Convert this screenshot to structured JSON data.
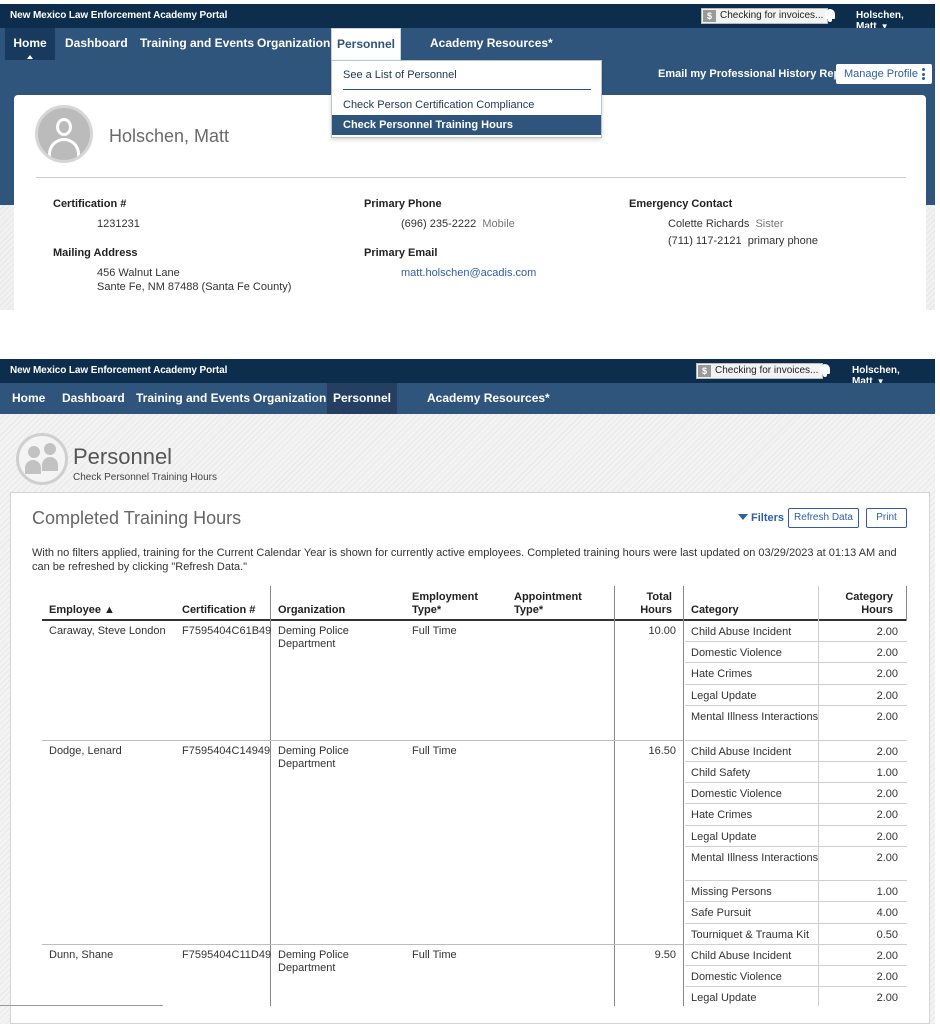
{
  "screen1": {
    "brand": "New Mexico Law Enforcement Academy Portal",
    "invoice_text": "Checking for invoices...",
    "invoice_icon": "dollar-icon",
    "user_name": "Holschen, Matt",
    "nav": {
      "home": "Home",
      "dashboard": "Dashboard",
      "training": "Training and Events",
      "organization": "Organization",
      "personnel": "Personnel",
      "resources": "Academy Resources*"
    },
    "dropdown": {
      "item1": "See a List of Personnel",
      "item2": "Check Person Certification Compliance",
      "item3": "Check Personnel Training Hours"
    },
    "email_report": "Email my Professional History Report",
    "manage_profile": "Manage Profile",
    "profile": {
      "name": "Holschen, Matt",
      "cert_label": "Certification #",
      "cert_value": "1231231",
      "mailing_label": "Mailing Address",
      "address_line1": "456 Walnut Lane",
      "address_line2": "Sante Fe, NM  87488 (Santa Fe County)",
      "phone_label": "Primary Phone",
      "phone_value": "(696) 235-2222",
      "phone_type": "Mobile",
      "email_label": "Primary Email",
      "email_value": "matt.holschen@acadis.com",
      "emergency_label": "Emergency Contact",
      "emergency_name": "Colette Richards",
      "emergency_relation": "Sister",
      "emergency_phone": "(711) 117-2121",
      "emergency_phone_type": "primary phone"
    }
  },
  "screen2": {
    "brand": "New Mexico Law Enforcement Academy Portal",
    "invoice_text": "Checking for invoices...",
    "user_name": "Holschen, Matt",
    "nav": {
      "home": "Home",
      "dashboard": "Dashboard",
      "training": "Training and Events",
      "organization": "Organization",
      "personnel": "Personnel",
      "resources": "Academy Resources*"
    },
    "page_title": "Personnel",
    "page_subtitle": "Check Personnel Training Hours",
    "heading": "Completed Training Hours",
    "filters": "Filters",
    "refresh": "Refresh Data",
    "print": "Print",
    "note": "With no filters applied, training for the Current Calendar Year is shown for currently active employees. Completed training hours were last updated on 03/29/2023 at 01:13 AM and can be refreshed by clicking \"Refresh Data.\"",
    "columns": {
      "employee": "Employee ▲",
      "certification": "Certification #",
      "organization": "Organization",
      "employment": "Employment Type*",
      "appointment": "Appointment Type*",
      "total": "Total Hours",
      "category": "Category",
      "category_hours": "Category Hours"
    },
    "rows": [
      {
        "employee": "Caraway, Steve London",
        "cert": "F7595404C61B49",
        "org": "Deming Police Department",
        "employment": "Full Time",
        "total": "10.00",
        "categories": [
          {
            "name": "Child Abuse Incident",
            "hours": "2.00"
          },
          {
            "name": "Domestic Violence",
            "hours": "2.00"
          },
          {
            "name": "Hate Crimes",
            "hours": "2.00"
          },
          {
            "name": "Legal Update",
            "hours": "2.00"
          },
          {
            "name": "Mental Illness Interactions",
            "hours": "2.00"
          }
        ]
      },
      {
        "employee": "Dodge, Lenard",
        "cert": "F7595404C14949",
        "org": "Deming Police Department",
        "employment": "Full Time",
        "total": "16.50",
        "categories": [
          {
            "name": "Child Abuse Incident",
            "hours": "2.00"
          },
          {
            "name": "Child Safety",
            "hours": "1.00"
          },
          {
            "name": "Domestic Violence",
            "hours": "2.00"
          },
          {
            "name": "Hate Crimes",
            "hours": "2.00"
          },
          {
            "name": "Legal Update",
            "hours": "2.00"
          },
          {
            "name": "Mental Illness Interactions",
            "hours": "2.00"
          },
          {
            "name": "Missing Persons",
            "hours": "1.00"
          },
          {
            "name": "Safe Pursuit",
            "hours": "4.00"
          },
          {
            "name": "Tourniquet & Trauma Kit",
            "hours": "0.50"
          }
        ]
      },
      {
        "employee": "Dunn, Shane",
        "cert": "F7595404C11D49",
        "org": "Deming Police Department",
        "employment": "Full Time",
        "total": "9.50",
        "categories": [
          {
            "name": "Child Abuse Incident",
            "hours": "2.00"
          },
          {
            "name": "Domestic Violence",
            "hours": "2.00"
          },
          {
            "name": "Legal Update",
            "hours": "2.00"
          }
        ]
      }
    ]
  }
}
